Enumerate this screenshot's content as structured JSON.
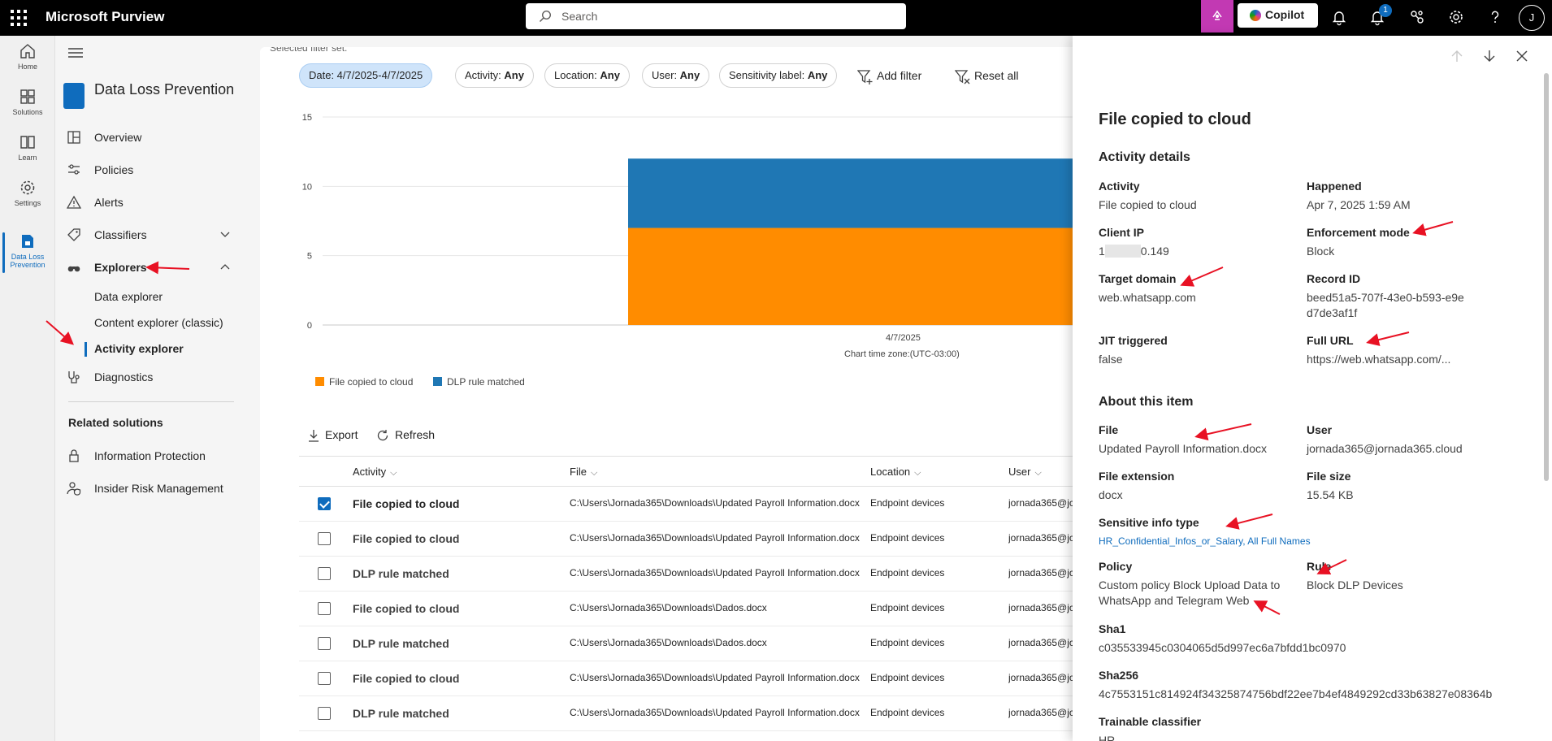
{
  "topbar": {
    "app_name": "Microsoft Purview",
    "search_placeholder": "Search",
    "copilot_label": "Copilot",
    "notification_count": "1",
    "avatar_initial": "J"
  },
  "rail": {
    "items": [
      {
        "label": "Home",
        "icon": "home-icon"
      },
      {
        "label": "Solutions",
        "icon": "solutions-icon"
      },
      {
        "label": "Learn",
        "icon": "learn-icon"
      },
      {
        "label": "Settings",
        "icon": "gear-icon"
      },
      {
        "label_line1": "Data Loss",
        "label_line2": "Prevention",
        "icon": "dlp-icon"
      }
    ]
  },
  "nav": {
    "title": "Data Loss Prevention",
    "items": {
      "overview": "Overview",
      "policies": "Policies",
      "alerts": "Alerts",
      "classifiers": "Classifiers",
      "explorers": "Explorers",
      "diagnostics": "Diagnostics"
    },
    "explorer_subitems": [
      "Data explorer",
      "Content explorer (classic)",
      "Activity explorer"
    ],
    "related_title": "Related solutions",
    "related": [
      "Information Protection",
      "Insider Risk Management"
    ]
  },
  "filters": {
    "selected_hint": "Selected filter set:",
    "chips": [
      {
        "key": "Date: 4/7/2025-4/7/2025",
        "val": ""
      },
      {
        "key": "Activity: ",
        "val": "Any"
      },
      {
        "key": "Location: ",
        "val": "Any"
      },
      {
        "key": "User: ",
        "val": "Any"
      },
      {
        "key": "Sensitivity label: ",
        "val": "Any"
      }
    ],
    "add_filter": "Add filter",
    "reset_all": "Reset all"
  },
  "chart_data": {
    "type": "bar",
    "stacked": true,
    "categories": [
      "4/7/2025"
    ],
    "series": [
      {
        "name": "File copied to cloud",
        "values": [
          7
        ],
        "color": "#ff8c00"
      },
      {
        "name": "DLP rule matched",
        "values": [
          5
        ],
        "color": "#1f77b4"
      }
    ],
    "ylim": [
      0,
      15
    ],
    "yticks": [
      "0",
      "5",
      "10",
      "15"
    ],
    "xlabel": "Chart time zone:(UTC-03:00)",
    "grid": true,
    "legend": "bottom-left"
  },
  "actions": {
    "export": "Export",
    "refresh": "Refresh"
  },
  "table": {
    "columns": [
      "Activity",
      "File",
      "Location",
      "User"
    ],
    "rows": [
      {
        "activity": "File copied to cloud",
        "file": "C:\\Users\\Jornada365\\Downloads\\Updated Payroll Information.docx",
        "location": "Endpoint devices",
        "user": "jornada365@jc",
        "checked": true
      },
      {
        "activity": "File copied to cloud",
        "file": "C:\\Users\\Jornada365\\Downloads\\Updated Payroll Information.docx",
        "location": "Endpoint devices",
        "user": "jornada365@jc",
        "checked": false
      },
      {
        "activity": "DLP rule matched",
        "file": "C:\\Users\\Jornada365\\Downloads\\Updated Payroll Information.docx",
        "location": "Endpoint devices",
        "user": "jornada365@jc",
        "checked": false
      },
      {
        "activity": "File copied to cloud",
        "file": "C:\\Users\\Jornada365\\Downloads\\Dados.docx",
        "location": "Endpoint devices",
        "user": "jornada365@jc",
        "checked": false
      },
      {
        "activity": "DLP rule matched",
        "file": "C:\\Users\\Jornada365\\Downloads\\Dados.docx",
        "location": "Endpoint devices",
        "user": "jornada365@jc",
        "checked": false
      },
      {
        "activity": "File copied to cloud",
        "file": "C:\\Users\\Jornada365\\Downloads\\Updated Payroll Information.docx",
        "location": "Endpoint devices",
        "user": "jornada365@jc",
        "checked": false
      },
      {
        "activity": "DLP rule matched",
        "file": "C:\\Users\\Jornada365\\Downloads\\Updated Payroll Information.docx",
        "location": "Endpoint devices",
        "user": "jornada365@jc",
        "checked": false
      }
    ]
  },
  "flyout": {
    "title": "File copied to cloud",
    "activity_details_heading": "Activity details",
    "about_heading": "About this item",
    "activity_details": {
      "activity": {
        "label": "Activity",
        "value": "File copied to cloud"
      },
      "happened": {
        "label": "Happened",
        "value": "Apr 7, 2025 1:59 AM"
      },
      "client_ip": {
        "label": "Client IP",
        "prefix": "1",
        "suffix": "0.149"
      },
      "enforcement_mode": {
        "label": "Enforcement mode",
        "value": "Block"
      },
      "target_domain": {
        "label": "Target domain",
        "value": "web.whatsapp.com"
      },
      "record_id": {
        "label": "Record ID",
        "value": "beed51a5-707f-43e0-b593-e9ed7de3af1f"
      },
      "jit_triggered": {
        "label": "JIT triggered",
        "value": "false"
      },
      "full_url": {
        "label": "Full URL",
        "value": "https://web.whatsapp.com/..."
      }
    },
    "about": {
      "file": {
        "label": "File",
        "value": "Updated Payroll Information.docx"
      },
      "user": {
        "label": "User",
        "value": "jornada365@jornada365.cloud"
      },
      "file_extension": {
        "label": "File extension",
        "value": "docx"
      },
      "file_size": {
        "label": "File size",
        "value": "15.54 KB"
      },
      "sensitive_info_type": {
        "label": "Sensitive info type",
        "value": "HR_Confidential_Infos_or_Salary, All Full Names"
      },
      "policy": {
        "label": "Policy",
        "value": "Custom policy Block Upload Data to WhatsApp and Telegram Web"
      },
      "rule": {
        "label": "Rule",
        "value": "Block DLP Devices"
      },
      "sha1": {
        "label": "Sha1",
        "value": "c035533945c0304065d5d997ec6a7bfdd1bc0970"
      },
      "sha256": {
        "label": "Sha256",
        "value": "4c7553151c814924f34325874756bdf22ee7b4ef4849292cd33b63827e08364b"
      },
      "trainable_classifier": {
        "label": "Trainable classifier",
        "value": "HR"
      }
    }
  },
  "colors": {
    "accent": "#0f6cbd",
    "annotation": "#e81123",
    "bar_orange": "#ff8c00",
    "bar_blue": "#1f77b4"
  }
}
